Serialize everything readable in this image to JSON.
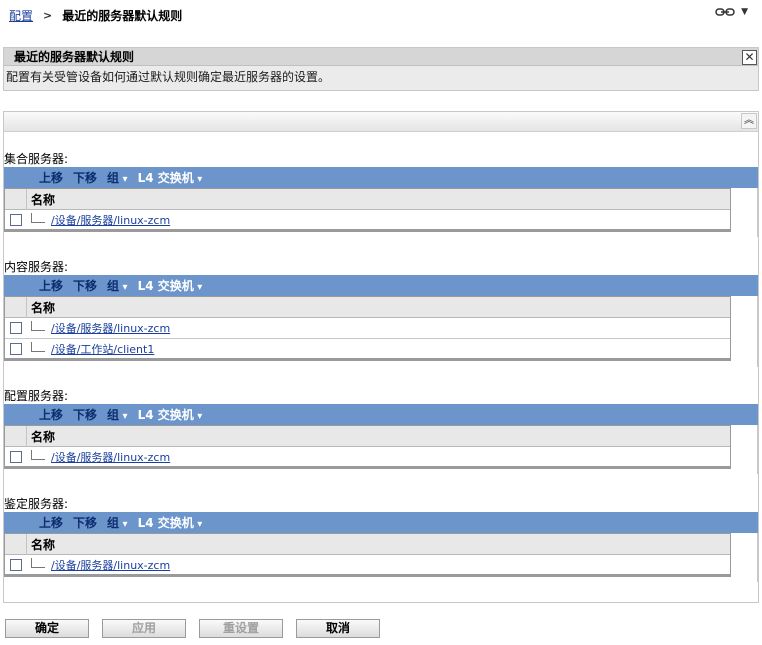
{
  "breadcrumb": {
    "root": "配置",
    "separator": ">",
    "current": "最近的服务器默认规则"
  },
  "header_icons": {
    "link_icon": "chain-link-icon",
    "menu_icon": "chevron-down-icon"
  },
  "info_box": {
    "title": "最近的服务器默认规则",
    "description": "配置有关受管设备如何通过默认规则确定最近服务器的设置。",
    "close_icon": "close-icon"
  },
  "panel": {
    "collapse_icon": "double-chevron-up-icon"
  },
  "toolbar": {
    "move_up": "上移",
    "move_down": "下移",
    "group": "组",
    "l4_switch": "L4 交换机"
  },
  "table": {
    "name_header": "名称"
  },
  "sections": [
    {
      "label": "集合服务器:",
      "rows": [
        {
          "name": "/设备/服务器/linux-zcm"
        }
      ]
    },
    {
      "label": "内容服务器:",
      "rows": [
        {
          "name": "/设备/服务器/linux-zcm"
        },
        {
          "name": "/设备/工作站/client1"
        }
      ]
    },
    {
      "label": "配置服务器:",
      "rows": [
        {
          "name": "/设备/服务器/linux-zcm"
        }
      ]
    },
    {
      "label": "鉴定服务器:",
      "rows": [
        {
          "name": "/设备/服务器/linux-zcm"
        }
      ]
    }
  ],
  "buttons": {
    "ok": "确定",
    "apply": "应用",
    "reset": "重设置",
    "cancel": "取消"
  },
  "colors": {
    "toolbar_bg": "#6c95cc",
    "link": "#1a3f9c",
    "info_bg": "#ebebeb"
  }
}
